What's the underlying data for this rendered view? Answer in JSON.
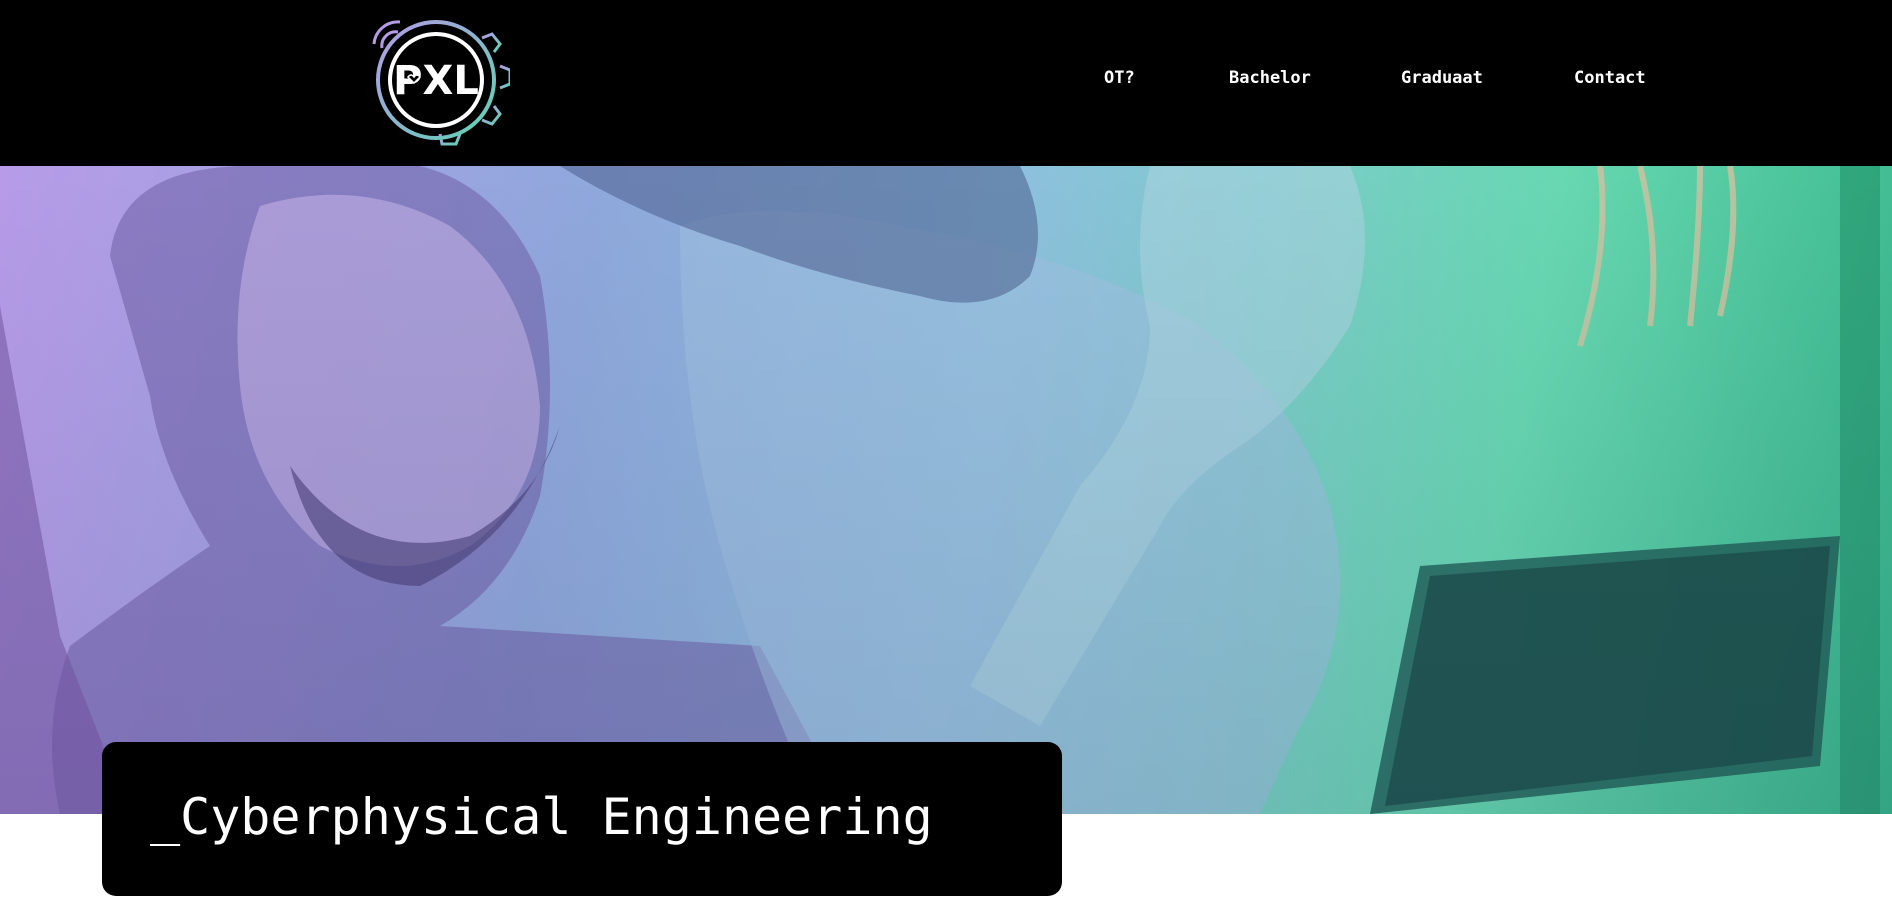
{
  "brand": {
    "logo_text": "PXL",
    "logo_name": "pxl-logo"
  },
  "nav": {
    "items": [
      {
        "label": "OT?"
      },
      {
        "label": "Bachelor"
      },
      {
        "label": "Graduaat"
      },
      {
        "label": "Contact"
      }
    ]
  },
  "hero": {
    "image_alt": "two engineers working with electronics",
    "gradient_colors": [
      "#b79be8",
      "#8fa8dc",
      "#8cc1dc",
      "#67d8b1",
      "#36b58a"
    ]
  },
  "page": {
    "title": "_Cyberphysical Engineering"
  },
  "colors": {
    "header_bg": "#000000",
    "text_on_dark": "#ffffff",
    "logo_ring_gradient_start": "#b59ae6",
    "logo_ring_gradient_end": "#5fd3b4"
  }
}
